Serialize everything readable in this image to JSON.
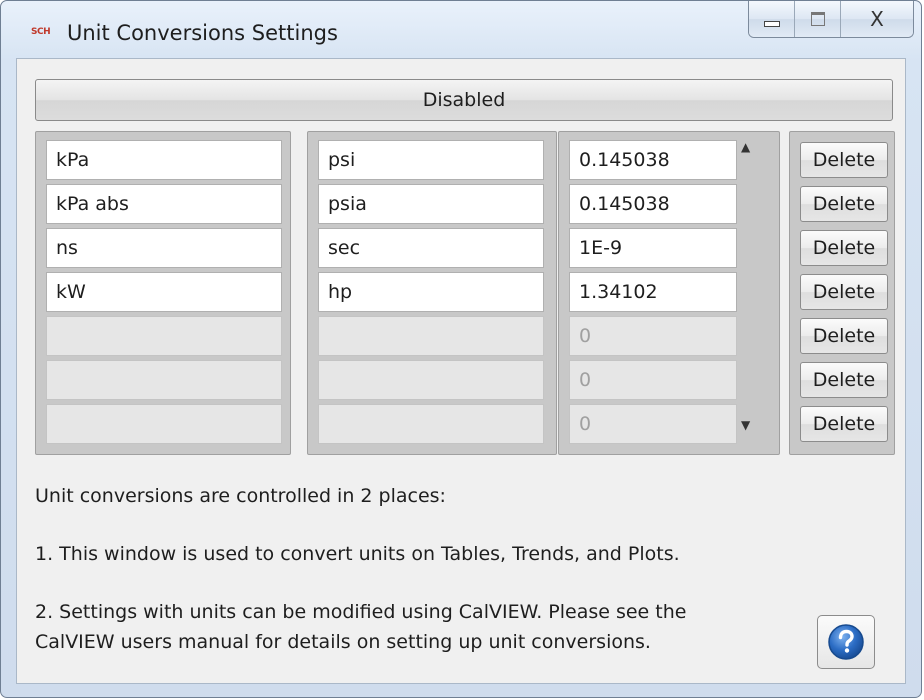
{
  "window": {
    "logo_text": "SCH",
    "title": "Unit Conversions Settings",
    "close_symbol": "X"
  },
  "toggle_label": "Disabled",
  "conversions": [
    {
      "from": "kPa",
      "to": "psi",
      "factor": "0.145038"
    },
    {
      "from": "kPa abs",
      "to": "psia",
      "factor": "0.145038"
    },
    {
      "from": "ns",
      "to": "sec",
      "factor": "1E-9"
    },
    {
      "from": "kW",
      "to": "hp",
      "factor": "1.34102"
    },
    {
      "from": "",
      "to": "",
      "factor": "0"
    },
    {
      "from": "",
      "to": "",
      "factor": "0"
    },
    {
      "from": "",
      "to": "",
      "factor": "0"
    }
  ],
  "delete_label": "Delete",
  "info": {
    "line1": "Unit conversions are controlled in 2 places:",
    "line2": "1. This window is used to convert units on Tables, Trends, and Plots.",
    "line3a": "2. Settings with units can be modified using CalVIEW. Please see the",
    "line3b": "CalVIEW users manual for details on setting up unit conversions."
  },
  "icons": {
    "help": "help-icon",
    "scroll_up": "scroll-up-arrow",
    "scroll_down": "scroll-down-arrow"
  },
  "colors": {
    "help_blue": "#2b6cc4",
    "logo_red": "#c0392b"
  }
}
